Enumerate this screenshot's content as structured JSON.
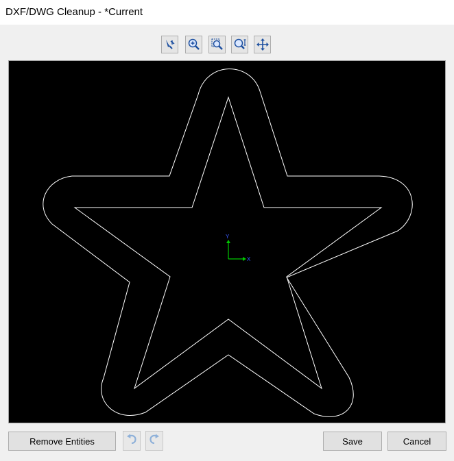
{
  "window": {
    "title": "DXF/DWG Cleanup - *Current"
  },
  "toolbar": {
    "buttons": [
      {
        "icon": "select-entity-icon"
      },
      {
        "icon": "zoom-in-icon"
      },
      {
        "icon": "zoom-window-icon"
      },
      {
        "icon": "zoom-extents-icon"
      },
      {
        "icon": "pan-icon"
      }
    ]
  },
  "canvas": {
    "background": "#000000",
    "entity_color": "#ffffff",
    "axis": {
      "x_label": "X",
      "y_label": "Y",
      "x_color": "#00c800",
      "y_color": "#00c800",
      "label_color": "#3a5bff"
    }
  },
  "footer": {
    "remove_entities_label": "Remove Entities",
    "undo_icon": "undo-icon",
    "redo_icon": "redo-icon",
    "save_label": "Save",
    "cancel_label": "Cancel"
  }
}
